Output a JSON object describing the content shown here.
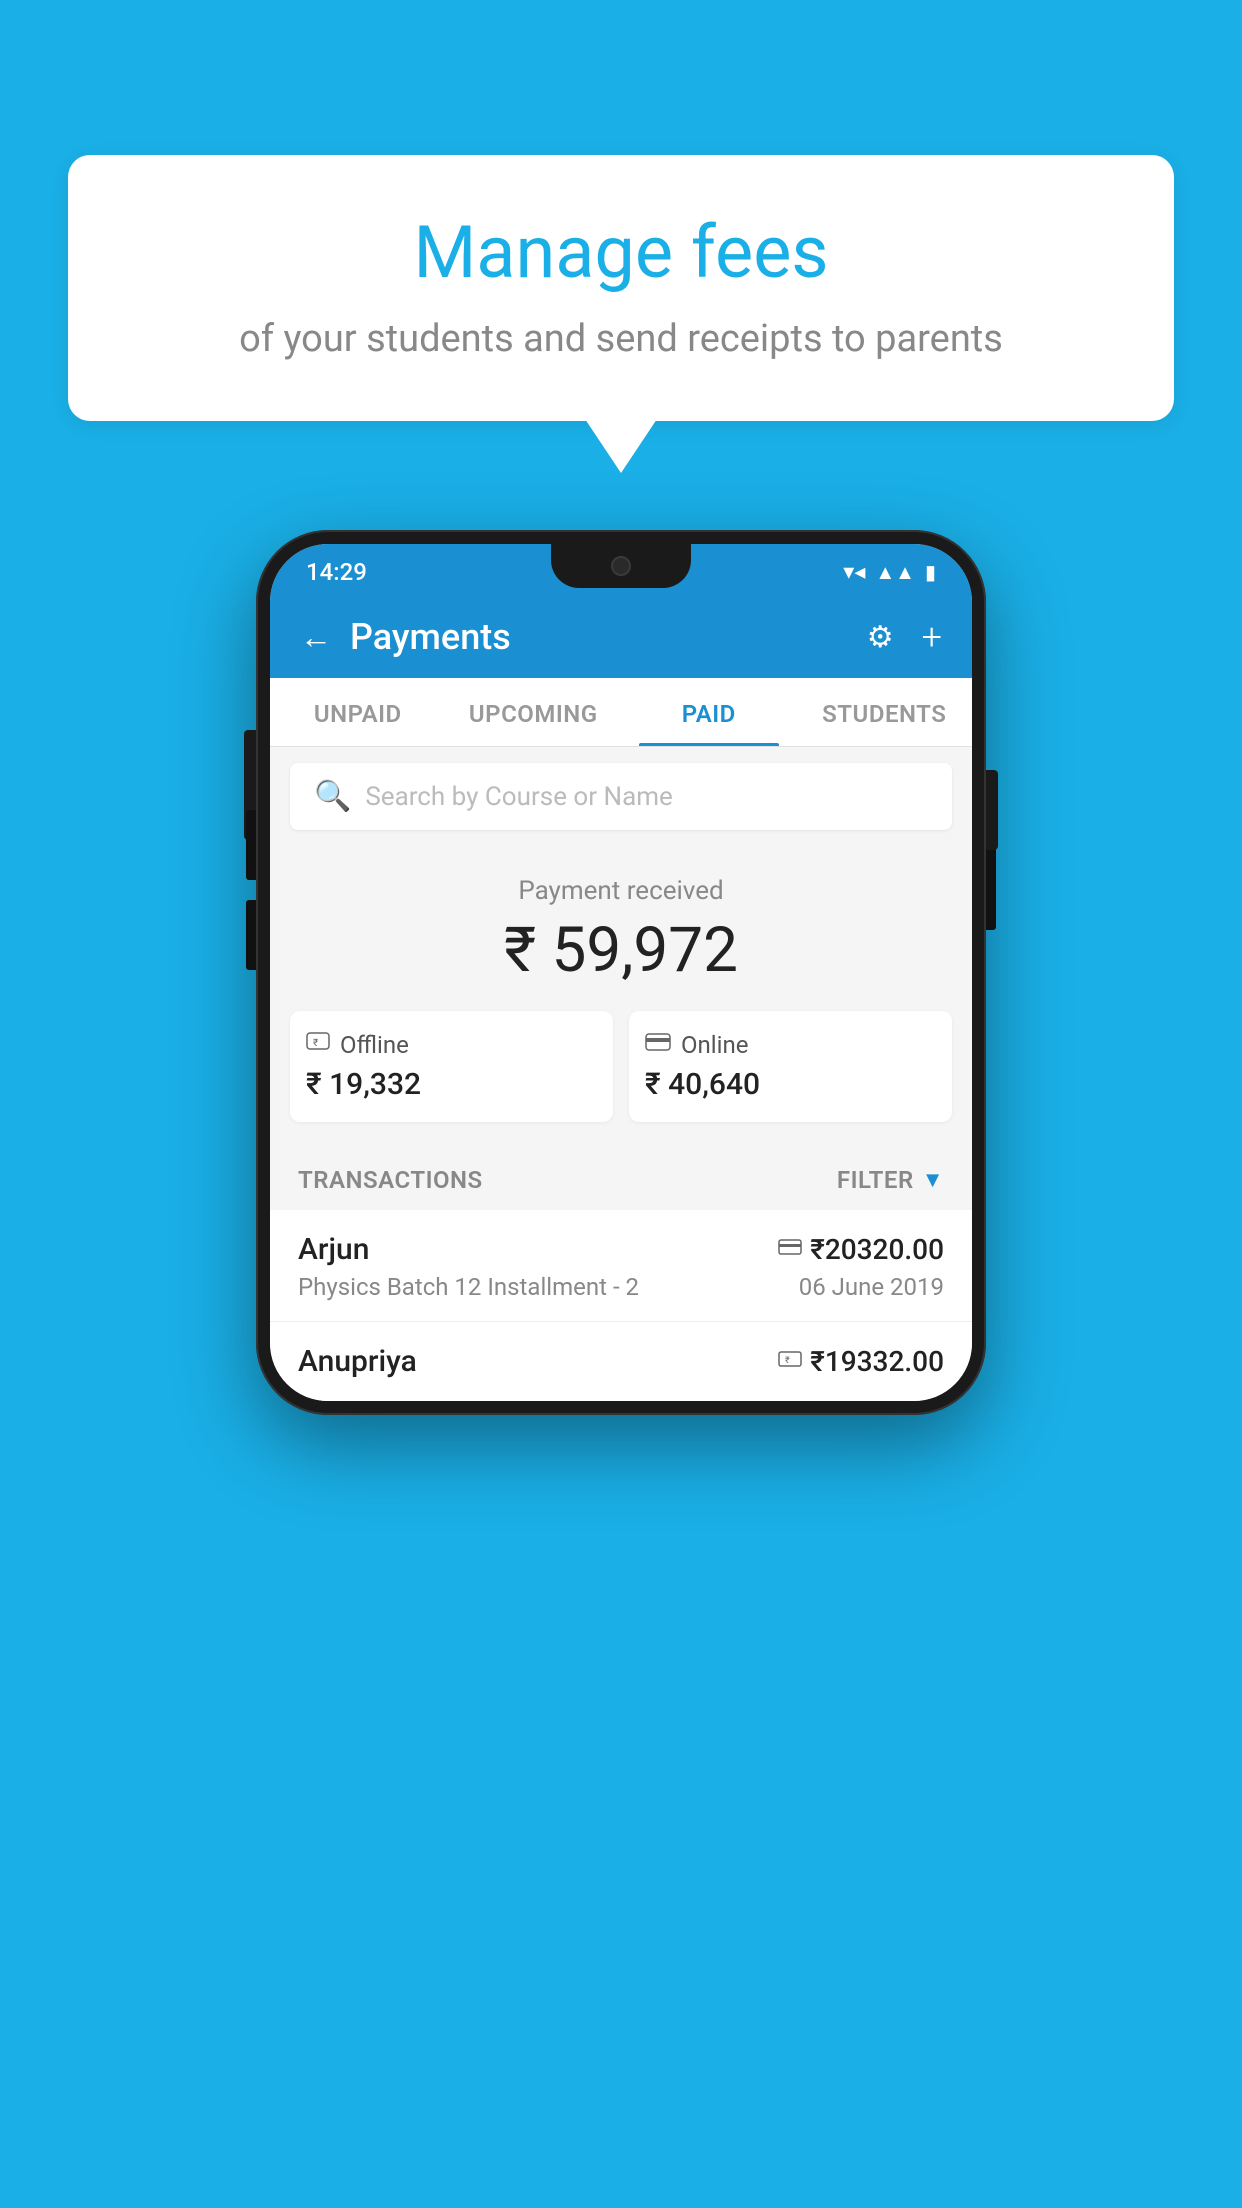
{
  "background_color": "#1AAFE6",
  "speech_bubble": {
    "title": "Manage fees",
    "subtitle": "of your students and send receipts to parents"
  },
  "phone": {
    "status_bar": {
      "time": "14:29",
      "icons": [
        "wifi",
        "signal",
        "battery"
      ]
    },
    "header": {
      "title": "Payments",
      "back_label": "←",
      "gear_label": "⚙",
      "plus_label": "+"
    },
    "tabs": [
      {
        "label": "UNPAID",
        "active": false
      },
      {
        "label": "UPCOMING",
        "active": false
      },
      {
        "label": "PAID",
        "active": true
      },
      {
        "label": "STUDENTS",
        "active": false
      }
    ],
    "search": {
      "placeholder": "Search by Course or Name"
    },
    "payment_summary": {
      "label": "Payment received",
      "total": "₹ 59,972",
      "offline": {
        "type": "Offline",
        "amount": "₹ 19,332",
        "icon": "💳"
      },
      "online": {
        "type": "Online",
        "amount": "₹ 40,640",
        "icon": "💳"
      }
    },
    "transactions": {
      "label": "TRANSACTIONS",
      "filter_label": "FILTER",
      "rows": [
        {
          "name": "Arjun",
          "amount": "₹20320.00",
          "course": "Physics Batch 12 Installment - 2",
          "date": "06 June 2019",
          "method_icon": "card"
        },
        {
          "name": "Anupriya",
          "amount": "₹19332.00",
          "course": "",
          "date": "",
          "method_icon": "cash"
        }
      ]
    }
  }
}
